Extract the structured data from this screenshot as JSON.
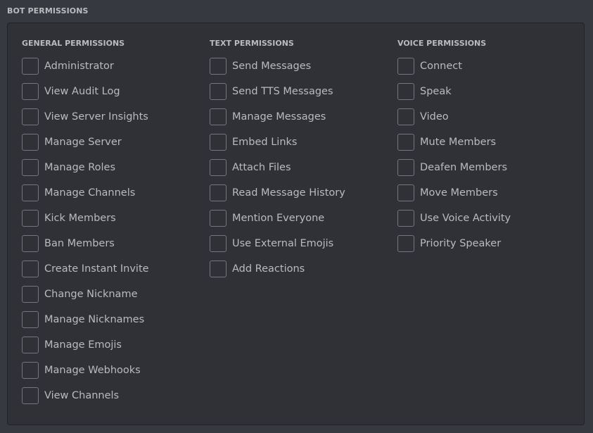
{
  "section_title": "BOT PERMISSIONS",
  "colors": {
    "background": "#36393f",
    "panel": "#2f3136",
    "text": "#b9bbbe",
    "checkbox_border": "#72767d"
  },
  "columns": [
    {
      "header": "GENERAL PERMISSIONS",
      "items": [
        {
          "label": "Administrator",
          "checked": false
        },
        {
          "label": "View Audit Log",
          "checked": false
        },
        {
          "label": "View Server Insights",
          "checked": false
        },
        {
          "label": "Manage Server",
          "checked": false
        },
        {
          "label": "Manage Roles",
          "checked": false
        },
        {
          "label": "Manage Channels",
          "checked": false
        },
        {
          "label": "Kick Members",
          "checked": false
        },
        {
          "label": "Ban Members",
          "checked": false
        },
        {
          "label": "Create Instant Invite",
          "checked": false
        },
        {
          "label": "Change Nickname",
          "checked": false
        },
        {
          "label": "Manage Nicknames",
          "checked": false
        },
        {
          "label": "Manage Emojis",
          "checked": false
        },
        {
          "label": "Manage Webhooks",
          "checked": false
        },
        {
          "label": "View Channels",
          "checked": false
        }
      ]
    },
    {
      "header": "TEXT PERMISSIONS",
      "items": [
        {
          "label": "Send Messages",
          "checked": false
        },
        {
          "label": "Send TTS Messages",
          "checked": false
        },
        {
          "label": "Manage Messages",
          "checked": false
        },
        {
          "label": "Embed Links",
          "checked": false
        },
        {
          "label": "Attach Files",
          "checked": false
        },
        {
          "label": "Read Message History",
          "checked": false
        },
        {
          "label": "Mention Everyone",
          "checked": false
        },
        {
          "label": "Use External Emojis",
          "checked": false
        },
        {
          "label": "Add Reactions",
          "checked": false
        }
      ]
    },
    {
      "header": "VOICE PERMISSIONS",
      "items": [
        {
          "label": "Connect",
          "checked": false
        },
        {
          "label": "Speak",
          "checked": false
        },
        {
          "label": "Video",
          "checked": false
        },
        {
          "label": "Mute Members",
          "checked": false
        },
        {
          "label": "Deafen Members",
          "checked": false
        },
        {
          "label": "Move Members",
          "checked": false
        },
        {
          "label": "Use Voice Activity",
          "checked": false
        },
        {
          "label": "Priority Speaker",
          "checked": false
        }
      ]
    }
  ]
}
